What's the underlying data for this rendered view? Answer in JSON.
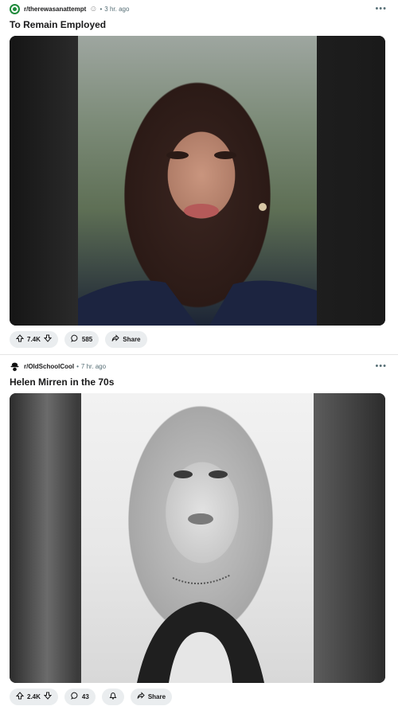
{
  "posts": [
    {
      "subreddit": "r/therewasanattempt",
      "time": "3 hr. ago",
      "title": "To Remain Employed",
      "upvotes": "7.4K",
      "comments": "585",
      "share_label": "Share",
      "image_style": "color-portrait"
    },
    {
      "subreddit": "r/OldSchoolCool",
      "time": "7 hr. ago",
      "title": "Helen Mirren in the 70s",
      "upvotes": "2.4K",
      "comments": "43",
      "share_label": "Share",
      "image_style": "bw-portrait"
    }
  ],
  "icons": {
    "subreddit1": "green-circle-icon",
    "subreddit2": "black-hat-icon",
    "upvote": "arrow-up-icon",
    "downvote": "arrow-down-icon",
    "comment": "speech-bubble-icon",
    "award": "award-icon",
    "share": "share-arrow-icon",
    "more": "ellipsis-icon"
  },
  "colors": {
    "pill_bg": "#eaedef",
    "meta_text": "#576f76",
    "title_text": "#1a1a1b"
  }
}
